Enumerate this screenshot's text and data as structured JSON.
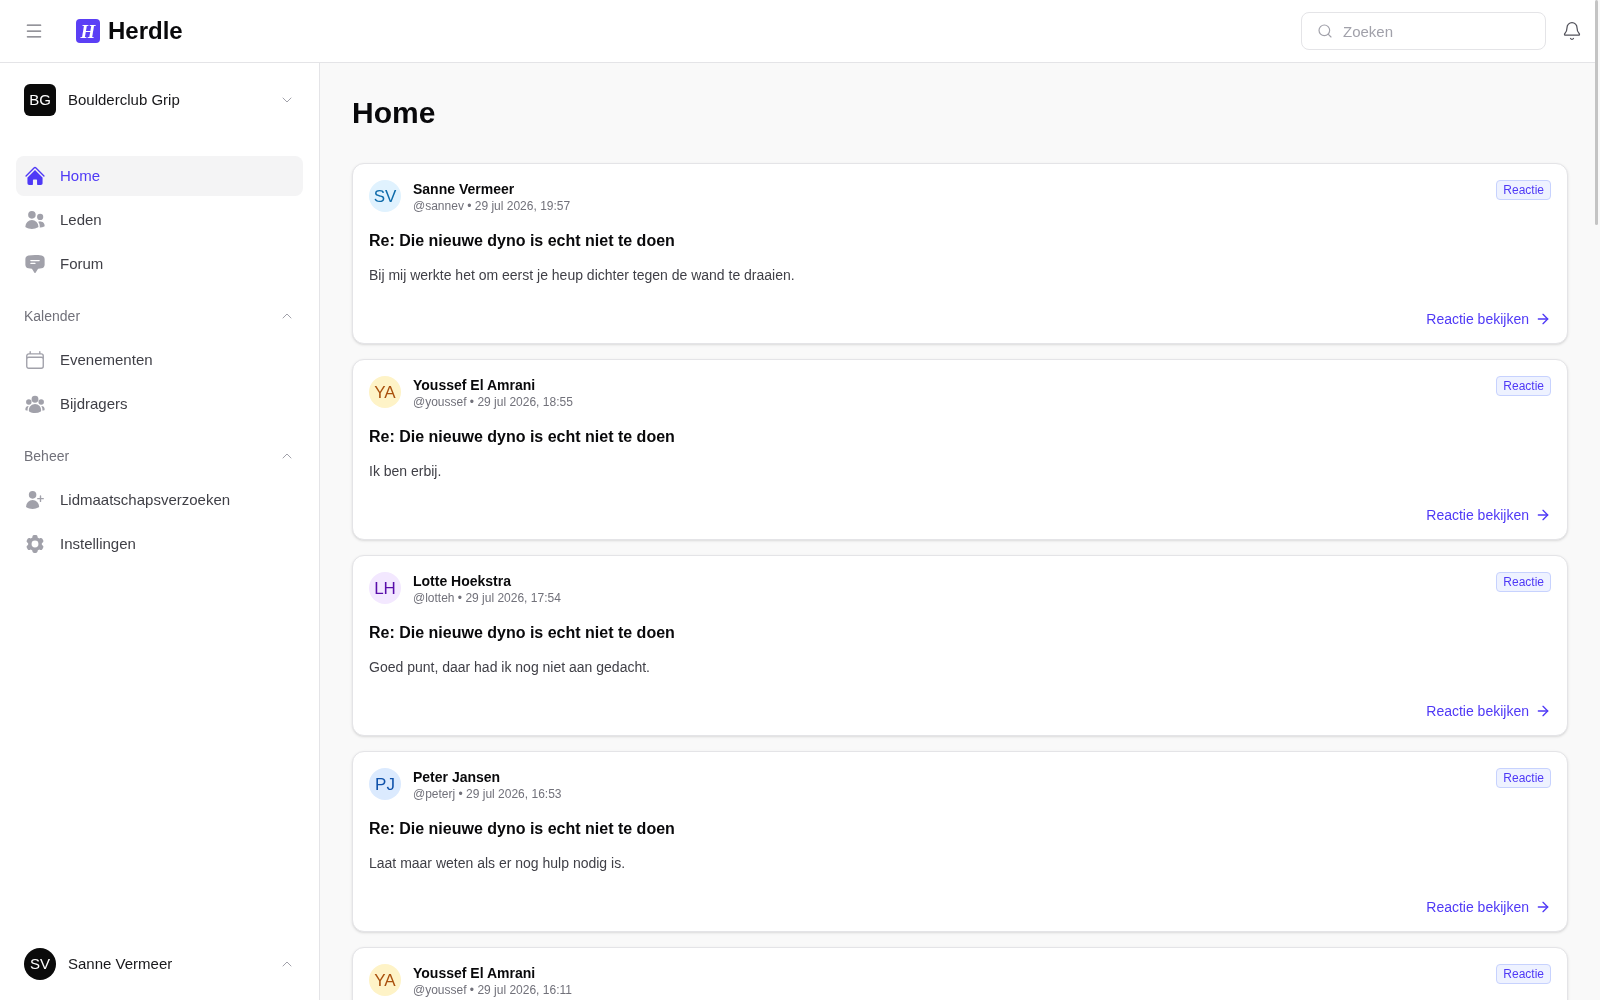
{
  "header": {
    "logo_mark": "H",
    "brand": "Herdle",
    "search": {
      "placeholder": "Zoeken"
    }
  },
  "sidebar": {
    "organization": {
      "initials": "BG",
      "name": "Boulderclub Grip"
    },
    "nav": [
      {
        "label": "Home",
        "selected": true
      },
      {
        "label": "Leden",
        "selected": false
      },
      {
        "label": "Forum",
        "selected": false
      }
    ],
    "sections": [
      {
        "title": "Kalender",
        "expanded": true,
        "items": [
          {
            "label": "Evenementen",
            "selected": false
          },
          {
            "label": "Bijdragers",
            "selected": false
          }
        ]
      },
      {
        "title": "Beheer",
        "expanded": true,
        "items": [
          {
            "label": "Lidmaatschapsverzoeken",
            "selected": false
          },
          {
            "label": "Instellingen",
            "selected": false
          }
        ]
      }
    ],
    "user": {
      "initials": "SV",
      "name": "Sanne Vermeer"
    }
  },
  "main": {
    "title": "Home",
    "posts": [
      {
        "author": {
          "initials": "SV",
          "name": "Sanne Vermeer",
          "color": "#e0f2fe"
        },
        "meta": "@sannev • 29 jul 2026, 19:57",
        "badge": "Reactie",
        "title": "Re: Die nieuwe dyno is echt niet te doen",
        "body": "Bij mij werkte het om eerst je heup dichter tegen de wand te draaien.",
        "link": "Reactie bekijken"
      },
      {
        "author": {
          "initials": "YA",
          "name": "Youssef El Amrani",
          "color": "#fef3c7"
        },
        "meta": "@youssef • 29 jul 2026, 18:55",
        "badge": "Reactie",
        "title": "Re: Die nieuwe dyno is echt niet te doen",
        "body": "Ik ben erbij.",
        "link": "Reactie bekijken"
      },
      {
        "author": {
          "initials": "LH",
          "name": "Lotte Hoekstra",
          "color": "#f3e8ff"
        },
        "meta": "@lotteh • 29 jul 2026, 17:54",
        "badge": "Reactie",
        "title": "Re: Die nieuwe dyno is echt niet te doen",
        "body": "Goed punt, daar had ik nog niet aan gedacht.",
        "link": "Reactie bekijken"
      },
      {
        "author": {
          "initials": "PJ",
          "name": "Peter Jansen",
          "color": "#dbeafe"
        },
        "meta": "@peterj • 29 jul 2026, 16:53",
        "badge": "Reactie",
        "title": "Re: Die nieuwe dyno is echt niet te doen",
        "body": "Laat maar weten als er nog hulp nodig is.",
        "link": "Reactie bekijken"
      },
      {
        "author": {
          "initials": "YA",
          "name": "Youssef El Amrani",
          "color": "#fef3c7"
        },
        "meta": "@youssef • 29 jul 2026, 16:11",
        "badge": "Reactie"
      }
    ]
  }
}
